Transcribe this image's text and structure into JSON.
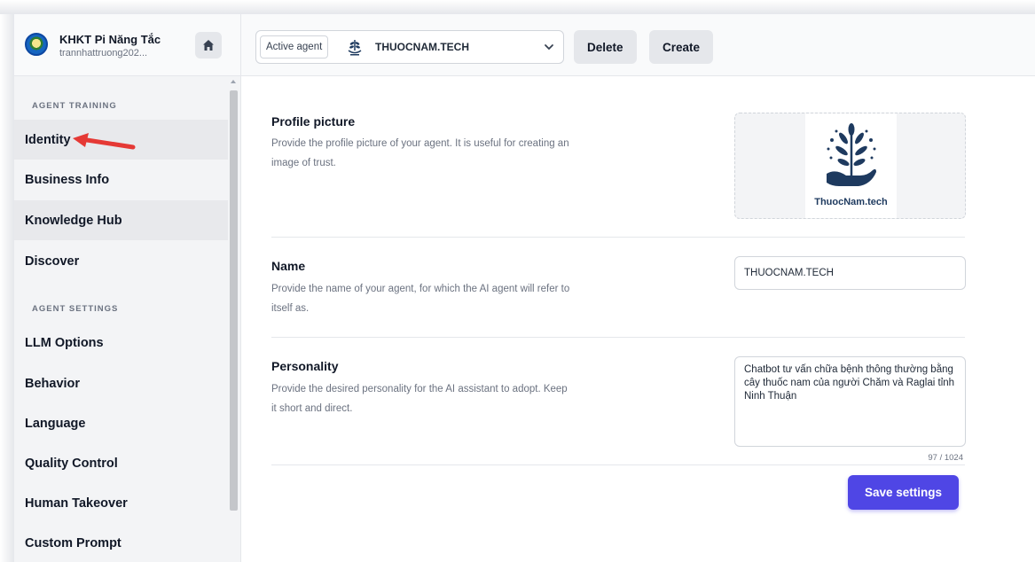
{
  "org": {
    "name": "KHKT Pi Năng Tắc",
    "user": "trannhattruong202..."
  },
  "agent": {
    "label": "Active agent",
    "name": "THUOCNAM.TECH",
    "delete_label": "Delete",
    "create_label": "Create"
  },
  "sidebar": {
    "section_training": "AGENT TRAINING",
    "section_settings": "AGENT SETTINGS",
    "training_items": [
      {
        "label": "Identity"
      },
      {
        "label": "Business Info"
      },
      {
        "label": "Knowledge Hub"
      },
      {
        "label": "Discover"
      }
    ],
    "settings_items": [
      {
        "label": "LLM Options"
      },
      {
        "label": "Behavior"
      },
      {
        "label": "Language"
      },
      {
        "label": "Quality Control"
      },
      {
        "label": "Human Takeover"
      },
      {
        "label": "Custom Prompt"
      }
    ]
  },
  "profile": {
    "title": "Profile picture",
    "description": "Provide the profile picture of your agent. It is useful for creating an image of trust.",
    "image_caption": "ThuocNam.tech"
  },
  "name_field": {
    "title": "Name",
    "description": "Provide the name of your agent, for which the AI agent will refer to itself as.",
    "value": "THUOCNAM.TECH"
  },
  "personality": {
    "title": "Personality",
    "description": "Provide the desired personality for the AI assistant to adopt. Keep it short and direct.",
    "value": "Chatbot tư vấn chữa bệnh thông thường bằng cây thuốc nam của người Chăm và Raglai tỉnh Ninh Thuận",
    "counter": "97 / 1024"
  },
  "save_label": "Save settings",
  "colors": {
    "accent": "#4f46e5",
    "annotation_arrow": "#e53935",
    "logo_navy": "#1e3a5f"
  },
  "icons": {
    "home": "home-icon",
    "chevron": "chevron-down-icon",
    "arrow": "red-annotation-arrow"
  }
}
